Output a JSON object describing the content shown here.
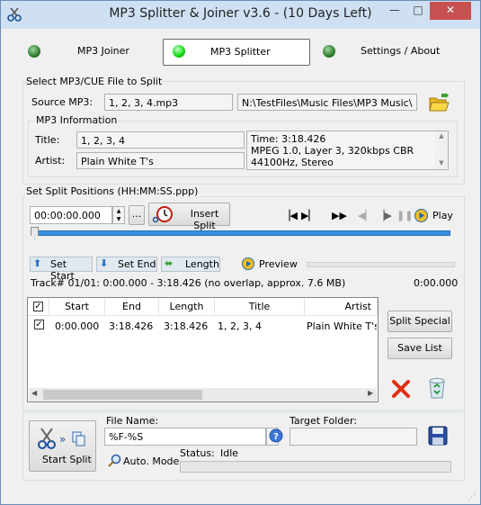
{
  "window": {
    "title": "MP3 Splitter & Joiner v3.6 - (10 Days Left)",
    "minimize": "—",
    "maximize": "□",
    "close": "✕"
  },
  "tabs": [
    {
      "label": "MP3 Joiner"
    },
    {
      "label": "MP3 Splitter"
    },
    {
      "label": "Settings / About"
    }
  ],
  "source_group": {
    "legend": "Select MP3/CUE File to Split",
    "source_label": "Source MP3:",
    "source_file": "1, 2, 3, 4.mp3",
    "source_path": "N:\\TestFiles\\Music Files\\MP3 Music\\",
    "info_legend": "MP3 Information",
    "title_label": "Title:",
    "title_value": "1, 2, 3, 4",
    "artist_label": "Artist:",
    "artist_value": "Plain White T's",
    "info_lines": [
      "Time: 3:18.426",
      "MPEG 1.0, Layer 3, 320kbps CBR",
      "44100Hz, Stereo"
    ]
  },
  "split_group": {
    "legend": "Set Split Positions (HH:MM:SS.ppp)",
    "position_value": "00:00:00.000",
    "browse_label": "...",
    "insert_split": "Insert Split",
    "play_label": "Play",
    "set_start": "Set Start",
    "set_end": "Set End",
    "length": "Length",
    "preview": "Preview",
    "track_info": "Track# 01/01: 0:00.000 - 3:18.426 (no overlap, approx. 7.6 MB)",
    "track_time": "0:00.000"
  },
  "table": {
    "columns": [
      "Start",
      "End",
      "Length",
      "Title",
      "Artist"
    ],
    "rows": [
      {
        "checked": "✓",
        "start": "0:00.000",
        "end": "3:18.426",
        "length": "3:18.426",
        "title": "1, 2, 3, 4",
        "artist": "Plain White T's"
      }
    ]
  },
  "side_buttons": {
    "split_special": "Split Special",
    "save_list": "Save List"
  },
  "bottom": {
    "start_split": "Start Split",
    "file_name_label": "File Name:",
    "file_name_value": "%F-%S",
    "target_folder_label": "Target Folder:",
    "target_folder_value": "",
    "auto_mode": "Auto. Mode",
    "status_label": "Status:",
    "status_value": "Idle",
    "progress": 0
  },
  "colors": {
    "accent": "#3b8fe0",
    "led_on": "#17e017",
    "delete": "#e03010"
  }
}
